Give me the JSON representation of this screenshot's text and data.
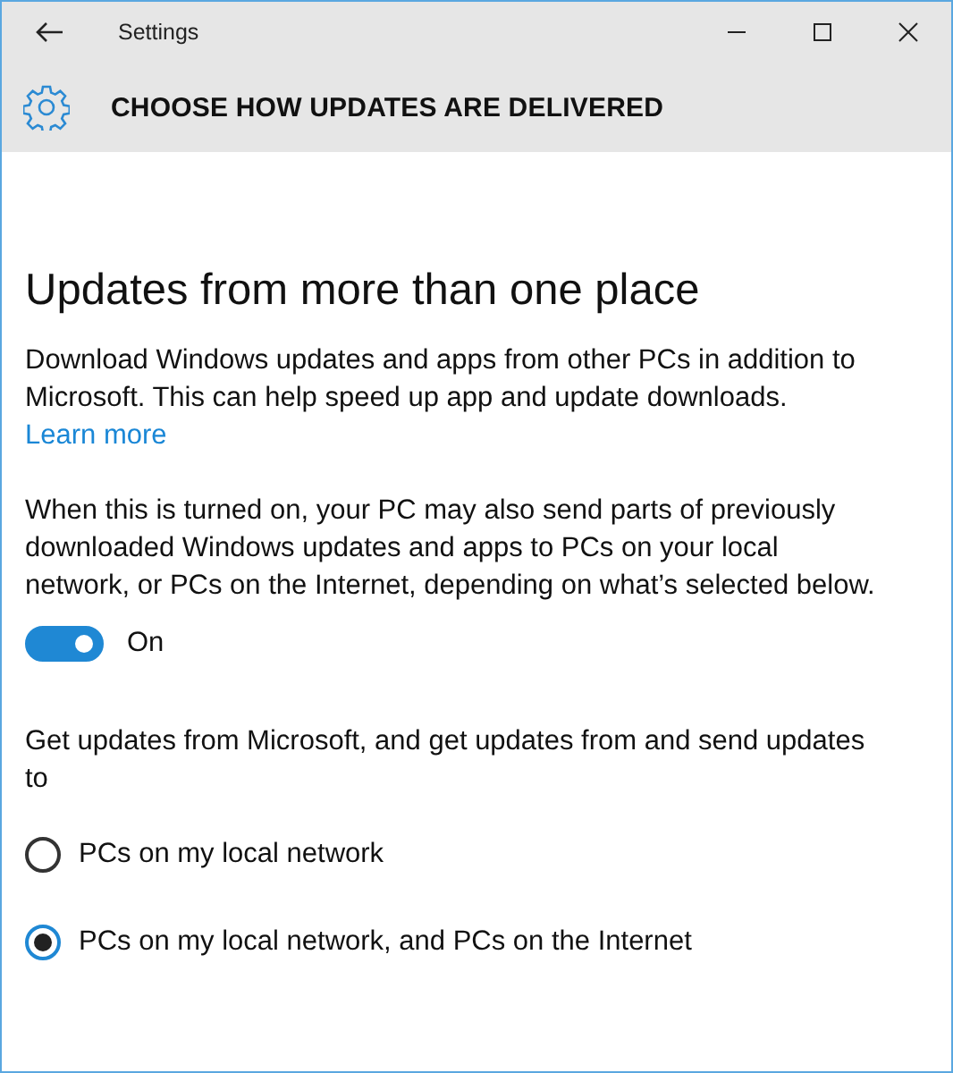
{
  "window": {
    "title": "Settings"
  },
  "header": {
    "title": "CHOOSE HOW UPDATES ARE DELIVERED"
  },
  "section": {
    "heading": "Updates from more than one place",
    "description": "Download Windows updates and apps from other PCs in addition to Microsoft. This can help speed up app and update downloads.",
    "link": "Learn more",
    "note": "When this is turned on, your PC may also send parts of previously downloaded Windows updates and apps to PCs on your local network, or PCs on the Internet, depending on what’s selected below.",
    "toggle": {
      "on": true,
      "label": "On"
    },
    "prompt": "Get updates from Microsoft, and get updates from and send updates to",
    "options": [
      {
        "label": "PCs on my local network",
        "selected": false
      },
      {
        "label": "PCs on my local network, and PCs on the Internet",
        "selected": true
      }
    ]
  }
}
